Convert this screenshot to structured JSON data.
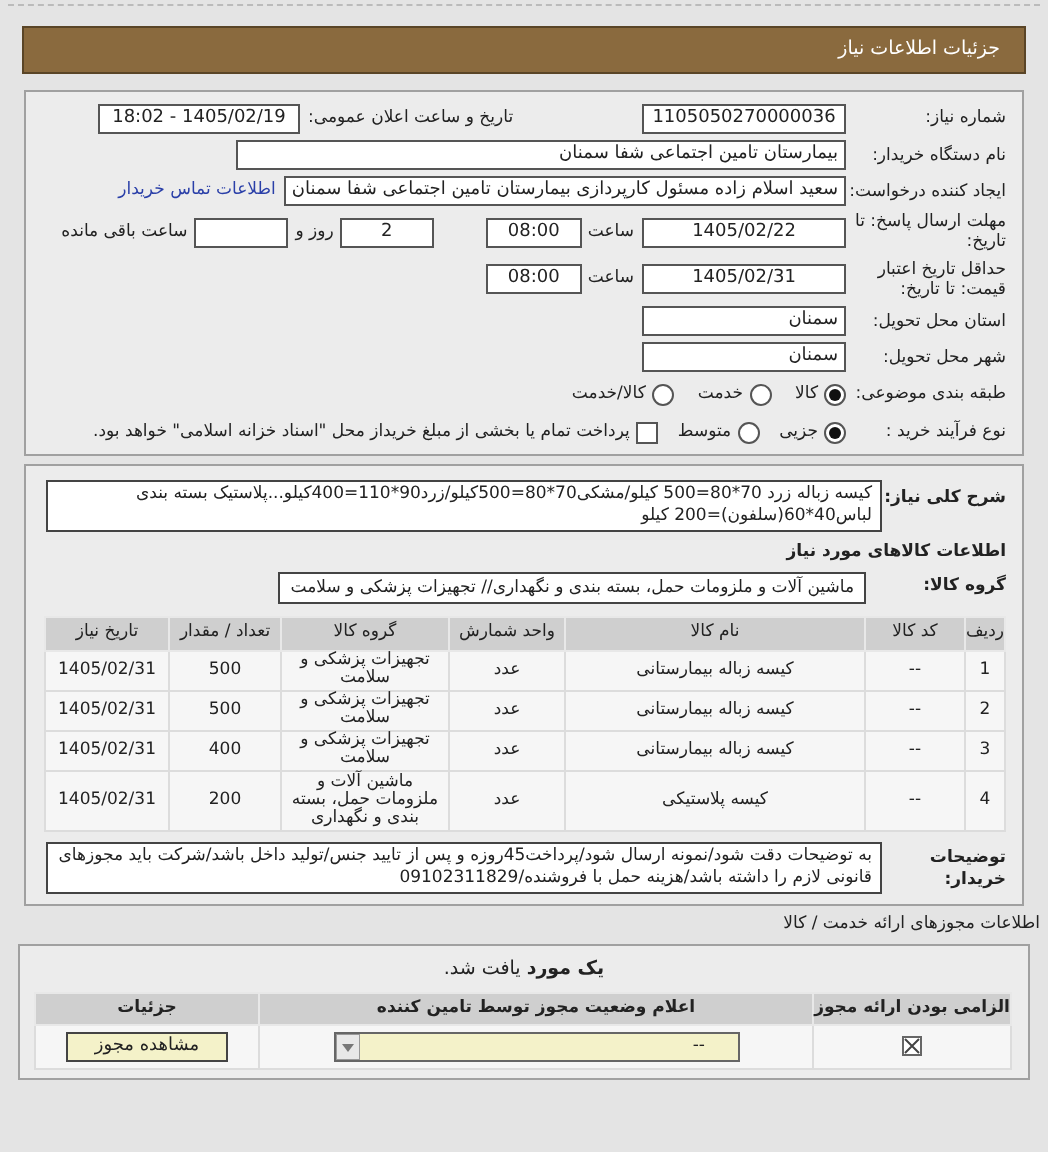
{
  "header": {
    "title": "جزئیات اطلاعات نیاز"
  },
  "need_number": {
    "label": "شماره نیاز:",
    "value": "1105050270000036"
  },
  "announce": {
    "label": "تاریخ و ساعت اعلان عمومی:",
    "value": "1405/02/19 - 18:02"
  },
  "buyer": {
    "label": "نام دستگاه خریدار:",
    "value": "بیمارستان تامین اجتماعی شفا سمنان"
  },
  "creator": {
    "label": "ایجاد کننده درخواست:",
    "value": "سعید اسلام زاده مسئول کارپردازی بیمارستان تامین اجتماعی شفا سمنان",
    "link": "اطلاعات تماس خریدار"
  },
  "deadline": {
    "label": "مهلت ارسال پاسخ: تا تاریخ:",
    "date": "1405/02/22",
    "time_label": "ساعت",
    "time": "08:00",
    "days": "2",
    "days_label": "روز و",
    "remaining_label": "ساعت باقی مانده"
  },
  "validity": {
    "label": "حداقل تاریخ اعتبار قیمت: تا تاریخ:",
    "date": "1405/02/31",
    "time_label": "ساعت",
    "time": "08:00"
  },
  "province": {
    "label": "استان محل تحویل:",
    "value": "سمنان"
  },
  "city": {
    "label": "شهر محل تحویل:",
    "value": "سمنان"
  },
  "category": {
    "label": "طبقه بندی موضوعی:",
    "options": [
      {
        "label": "کالا",
        "selected": true
      },
      {
        "label": "خدمت",
        "selected": false
      },
      {
        "label": "کالا/خدمت",
        "selected": false
      }
    ]
  },
  "process": {
    "label": "نوع فرآیند خرید :",
    "options": [
      {
        "label": "جزیی",
        "selected": true
      },
      {
        "label": "متوسط",
        "selected": false
      }
    ],
    "treasury": {
      "label": "پرداخت تمام یا بخشی از مبلغ خریداز محل \"اسناد خزانه اسلامی\" خواهد بود.",
      "checked": false
    }
  },
  "description": {
    "label": "شرح کلی نیاز:",
    "value": "کیسه زباله زرد 70*80=500 کیلو/مشکی70*80=500کیلو/زرد90*110=400کیلو...پلاستیک بسته بندی لباس40*60(سلفون)=200 کیلو"
  },
  "goods_title": "اطلاعات کالاهای مورد نیاز",
  "group": {
    "label": "گروه کالا:",
    "value": "ماشین آلات و ملزومات حمل، بسته بندی و نگهداری// تجهیزات پزشکی و سلامت"
  },
  "table": {
    "columns": [
      "ردیف",
      "کد کالا",
      "نام کالا",
      "واحد شمارش",
      "گروه کالا",
      "تعداد / مقدار",
      "تاریخ نیاز"
    ],
    "rows": [
      [
        "1",
        "--",
        "کیسه زباله بیمارستانی",
        "عدد",
        "تجهیزات پزشکی و سلامت",
        "500",
        "1405/02/31"
      ],
      [
        "2",
        "--",
        "کیسه زباله بیمارستانی",
        "عدد",
        "تجهیزات پزشکی و سلامت",
        "500",
        "1405/02/31"
      ],
      [
        "3",
        "--",
        "کیسه زباله بیمارستانی",
        "عدد",
        "تجهیزات پزشکی و سلامت",
        "400",
        "1405/02/31"
      ],
      [
        "4",
        "--",
        "کیسه پلاستیکی",
        "عدد",
        "ماشین آلات و ملزومات حمل، بسته بندی و نگهداری",
        "200",
        "1405/02/31"
      ]
    ]
  },
  "notes": {
    "label": "توضیحات خریدار:",
    "value": "به توضیحات دقت شود/نمونه ارسال شود/پرداخت45روزه و پس از تایید جنس/تولید داخل باشد/شرکت باید مجوزهای قانونی لازم را داشته باشد/هزینه حمل با فروشنده/09102311829"
  },
  "licenses": {
    "title": "اطلاعات مجوزهای ارائه خدمت / کالا",
    "found": "**یک مورد** یافت شد.",
    "columns": [
      "الزامی بودن ارائه مجوز",
      "اعلام وضعیت مجوز توسط تامین کننده",
      "جزئیات"
    ],
    "rows": [
      {
        "required": true,
        "status": "--",
        "action": "مشاهده مجوز"
      }
    ]
  }
}
